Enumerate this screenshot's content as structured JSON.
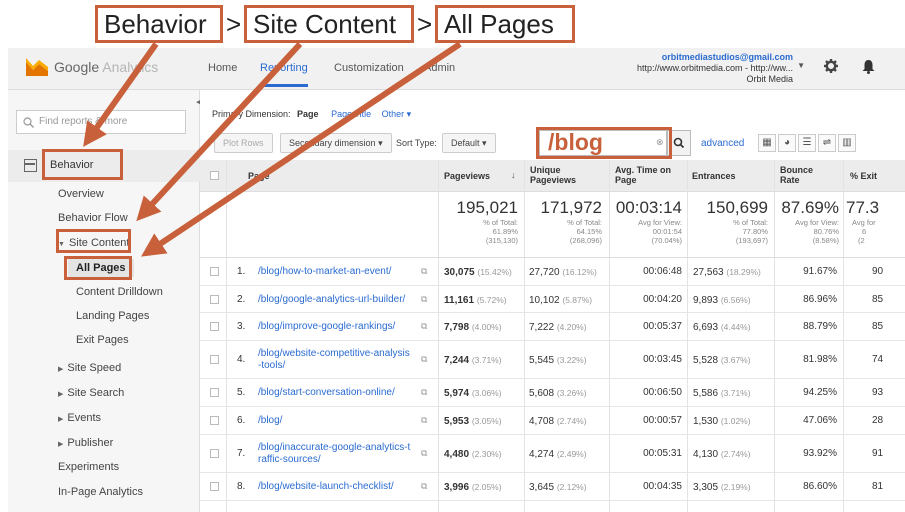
{
  "breadcrumb": {
    "part1": "Behavior",
    "sep1": ">",
    "part2": "Site Content",
    "sep2": ">",
    "part3": "All Pages"
  },
  "header": {
    "logo_brand": "Google",
    "logo_sub": "Analytics",
    "nav": {
      "home": "Home",
      "reporting": "Reporting",
      "customization": "Customization",
      "admin": "Admin"
    },
    "account": {
      "email": "orbitmediastudios@gmail.com",
      "url": "http://www.orbitmedia.com - http://ww...",
      "name": "Orbit Media"
    },
    "icons": {
      "settings": "gear-icon",
      "notifications": "bell-icon"
    }
  },
  "sidebar": {
    "search_placeholder": "Find reports & more",
    "section": "Behavior",
    "items": {
      "overview": "Overview",
      "behavior_flow": "Behavior Flow",
      "site_content": "Site Content",
      "all_pages": "All Pages",
      "content_drilldown": "Content Drilldown",
      "landing_pages": "Landing Pages",
      "exit_pages": "Exit Pages",
      "site_speed": "Site Speed",
      "site_search": "Site Search",
      "events": "Events",
      "publisher": "Publisher",
      "experiments": "Experiments",
      "in_page_analytics": "In-Page Analytics"
    }
  },
  "toolbar": {
    "primary_dimension_label": "Primary Dimension:",
    "dim_page": "Page",
    "dim_page_title": "Page Title",
    "dim_other": "Other",
    "plot_rows": "Plot Rows",
    "secondary_dimension": "Secondary dimension",
    "sort_type_label": "Sort Type:",
    "sort_default": "Default",
    "filter_value": "/blog",
    "advanced": "advanced"
  },
  "table": {
    "headers": {
      "page": "Page",
      "pageviews": "Pageviews",
      "unique_pageviews": "Unique Pageviews",
      "avg_time": "Avg. Time on Page",
      "entrances": "Entrances",
      "bounce_rate": "Bounce Rate",
      "exit": "% Exit"
    },
    "totals": {
      "pageviews": {
        "value": "195,021",
        "l1": "% of Total:",
        "l2": "61.89%",
        "l3": "(315,130)"
      },
      "unique": {
        "value": "171,972",
        "l1": "% of Total:",
        "l2": "64.15%",
        "l3": "(268,096)"
      },
      "avg_time": {
        "value": "00:03:14",
        "l1": "Avg for View:",
        "l2": "00:01:54",
        "l3": "(70.04%)"
      },
      "entrances": {
        "value": "150,699",
        "l1": "% of Total:",
        "l2": "77.80%",
        "l3": "(193,697)"
      },
      "bounce": {
        "value": "87.69%",
        "l1": "Avg for View:",
        "l2": "80.76%",
        "l3": "(8.58%)"
      },
      "exit": {
        "value": "77.3",
        "l1": "Avg for",
        "l2": "6",
        "l3": "(2"
      }
    },
    "rows": [
      {
        "n": "1.",
        "page1": "/blog/how-to-market-an-event/",
        "page2": "",
        "pv": "30,075",
        "pvp": "(15.42%)",
        "upv": "27,720",
        "upvp": "(16.12%)",
        "time": "00:06:48",
        "ent": "27,563",
        "entp": "(18.29%)",
        "br": "91.67%",
        "ex": "90"
      },
      {
        "n": "2.",
        "page1": "/blog/google-analytics-url-builder/",
        "page2": "",
        "pv": "11,161",
        "pvp": "(5.72%)",
        "upv": "10,102",
        "upvp": "(5.87%)",
        "time": "00:04:20",
        "ent": "9,893",
        "entp": "(6.56%)",
        "br": "86.96%",
        "ex": "85"
      },
      {
        "n": "3.",
        "page1": "/blog/improve-google-rankings/",
        "page2": "",
        "pv": "7,798",
        "pvp": "(4.00%)",
        "upv": "7,222",
        "upvp": "(4.20%)",
        "time": "00:05:37",
        "ent": "6,693",
        "entp": "(4.44%)",
        "br": "88.79%",
        "ex": "85"
      },
      {
        "n": "4.",
        "page1": "/blog/website-competitive-analysis",
        "page2": "-tools/",
        "pv": "7,244",
        "pvp": "(3.71%)",
        "upv": "5,545",
        "upvp": "(3.22%)",
        "time": "00:03:45",
        "ent": "5,528",
        "entp": "(3.67%)",
        "br": "81.98%",
        "ex": "74"
      },
      {
        "n": "5.",
        "page1": "/blog/start-conversation-online/",
        "page2": "",
        "pv": "5,974",
        "pvp": "(3.06%)",
        "upv": "5,608",
        "upvp": "(3.26%)",
        "time": "00:06:50",
        "ent": "5,586",
        "entp": "(3.71%)",
        "br": "94.25%",
        "ex": "93"
      },
      {
        "n": "6.",
        "page1": "/blog/",
        "page2": "",
        "pv": "5,953",
        "pvp": "(3.05%)",
        "upv": "4,708",
        "upvp": "(2.74%)",
        "time": "00:00:57",
        "ent": "1,530",
        "entp": "(1.02%)",
        "br": "47.06%",
        "ex": "28"
      },
      {
        "n": "7.",
        "page1": "/blog/inaccurate-google-analytics-t",
        "page2": "raffic-sources/",
        "pv": "4,480",
        "pvp": "(2.30%)",
        "upv": "4,274",
        "upvp": "(2.49%)",
        "time": "00:05:31",
        "ent": "4,130",
        "entp": "(2.74%)",
        "br": "93.92%",
        "ex": "91"
      },
      {
        "n": "8.",
        "page1": "/blog/website-launch-checklist/",
        "page2": "",
        "pv": "3,996",
        "pvp": "(2.05%)",
        "upv": "3,645",
        "upvp": "(2.12%)",
        "time": "00:04:35",
        "ent": "3,305",
        "entp": "(2.19%)",
        "br": "86.60%",
        "ex": "81"
      }
    ]
  },
  "colors": {
    "annotation": "#c8613b",
    "link": "#2a6bd1"
  }
}
